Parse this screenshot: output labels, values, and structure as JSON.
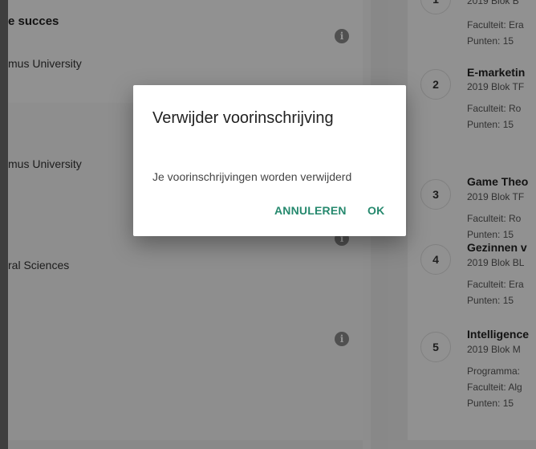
{
  "left": {
    "card1_title": "e succes",
    "card1_university": "mus University",
    "card2_university": "mus University",
    "card2_sciences": "ral Sciences",
    "info_icon_glyph": "i"
  },
  "courses": [
    {
      "number": "1",
      "title": "",
      "subtitle": "2019 Blok B",
      "faculty": "Faculteit: Era",
      "points": "Punten: 15"
    },
    {
      "number": "2",
      "title": "E-marketin",
      "subtitle": "2019 Blok TF",
      "faculty": "Faculteit: Ro",
      "points": "Punten: 15"
    },
    {
      "number": "3",
      "title": "Game Theo",
      "subtitle": "2019 Blok TF",
      "faculty": "Faculteit: Ro",
      "points": "Punten: 15"
    },
    {
      "number": "4",
      "title": "Gezinnen v",
      "subtitle": "2019 Blok BL",
      "faculty": "Faculteit: Era",
      "points": "Punten: 15"
    },
    {
      "number": "5",
      "title": "Intelligence",
      "subtitle": "2019 Blok M",
      "programme": "Programma:",
      "faculty": "Faculteit: Alg",
      "points": "Punten: 15"
    }
  ],
  "dialog": {
    "title": "Verwijder voorinschrijving",
    "message": "Je voorinschrijvingen worden verwijderd",
    "cancel_label": "ANNULEREN",
    "ok_label": "OK",
    "accent_color": "#26896e"
  }
}
